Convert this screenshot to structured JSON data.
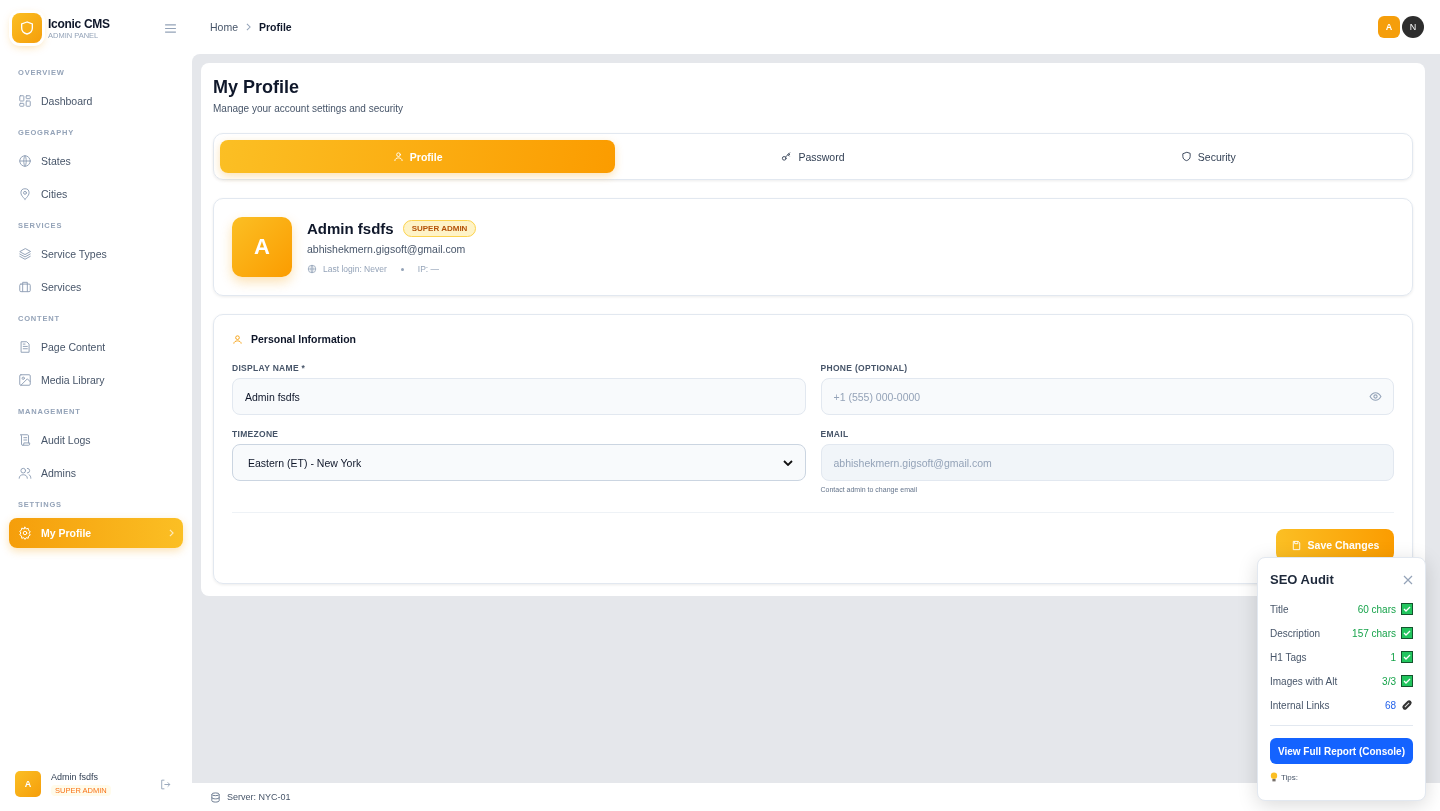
{
  "brand": {
    "name": "Iconic CMS",
    "subtitle": "ADMIN PANEL"
  },
  "nav": [
    {
      "heading": "OVERVIEW",
      "items": [
        {
          "label": "Dashboard",
          "selected": false
        }
      ]
    },
    {
      "heading": "GEOGRAPHY",
      "items": [
        {
          "label": "States",
          "selected": false
        },
        {
          "label": "Cities",
          "selected": false
        }
      ]
    },
    {
      "heading": "SERVICES",
      "items": [
        {
          "label": "Service Types",
          "selected": false
        },
        {
          "label": "Services",
          "selected": false
        }
      ]
    },
    {
      "heading": "CONTENT",
      "items": [
        {
          "label": "Page Content",
          "selected": false
        },
        {
          "label": "Media Library",
          "selected": false
        }
      ]
    },
    {
      "heading": "MANAGEMENT",
      "items": [
        {
          "label": "Audit Logs",
          "selected": false
        },
        {
          "label": "Admins",
          "selected": false
        }
      ]
    },
    {
      "heading": "SETTINGS",
      "items": [
        {
          "label": "My Profile",
          "selected": true
        }
      ]
    }
  ],
  "sidebar_user": {
    "avatar": "A",
    "name": "Admin fsdfs",
    "role": "SUPER ADMIN"
  },
  "breadcrumb": [
    "Home",
    "Profile"
  ],
  "top_avatars": [
    "A",
    "N"
  ],
  "page": {
    "title": "My Profile",
    "subtitle": "Manage your account settings and security"
  },
  "tabs": [
    {
      "label": "Profile",
      "selected": true
    },
    {
      "label": "Password",
      "selected": false
    },
    {
      "label": "Security",
      "selected": false
    }
  ],
  "profile": {
    "avatar": "A",
    "name": "Admin fsdfs",
    "badge": "SUPER ADMIN",
    "email": "abhishekmern.gigsoft@gmail.com",
    "last_login": "Last login: Never",
    "ip": "IP: —"
  },
  "personal": {
    "heading": "Personal Information",
    "fields": [
      {
        "label": "DISPLAY NAME *",
        "kind": "text",
        "value": "Admin fsdfs"
      },
      {
        "label": "PHONE (OPTIONAL)",
        "kind": "phone",
        "placeholder": "+1 (555) 000-0000"
      },
      {
        "label": "TIMEZONE",
        "kind": "select",
        "value": "Eastern (ET) - New York"
      },
      {
        "label": "EMAIL",
        "kind": "readonly",
        "value": "abhishekmern.gigsoft@gmail.com",
        "hint": "Contact admin to change email"
      }
    ],
    "save": "Save Changes"
  },
  "footer": {
    "server": "Server: NYC-01"
  },
  "seo": {
    "title": "SEO Audit",
    "rows": [
      {
        "label": "Title",
        "value": "60 chars",
        "kind": "ok"
      },
      {
        "label": "Description",
        "value": "157 chars",
        "kind": "ok"
      },
      {
        "label": "H1 Tags",
        "value": "1",
        "kind": "ok"
      },
      {
        "label": "Images with Alt",
        "value": "3/3",
        "kind": "ok"
      },
      {
        "label": "Internal Links",
        "value": "68",
        "kind": "info"
      }
    ],
    "button": "View Full Report (Console)",
    "tips": "Tips:"
  }
}
